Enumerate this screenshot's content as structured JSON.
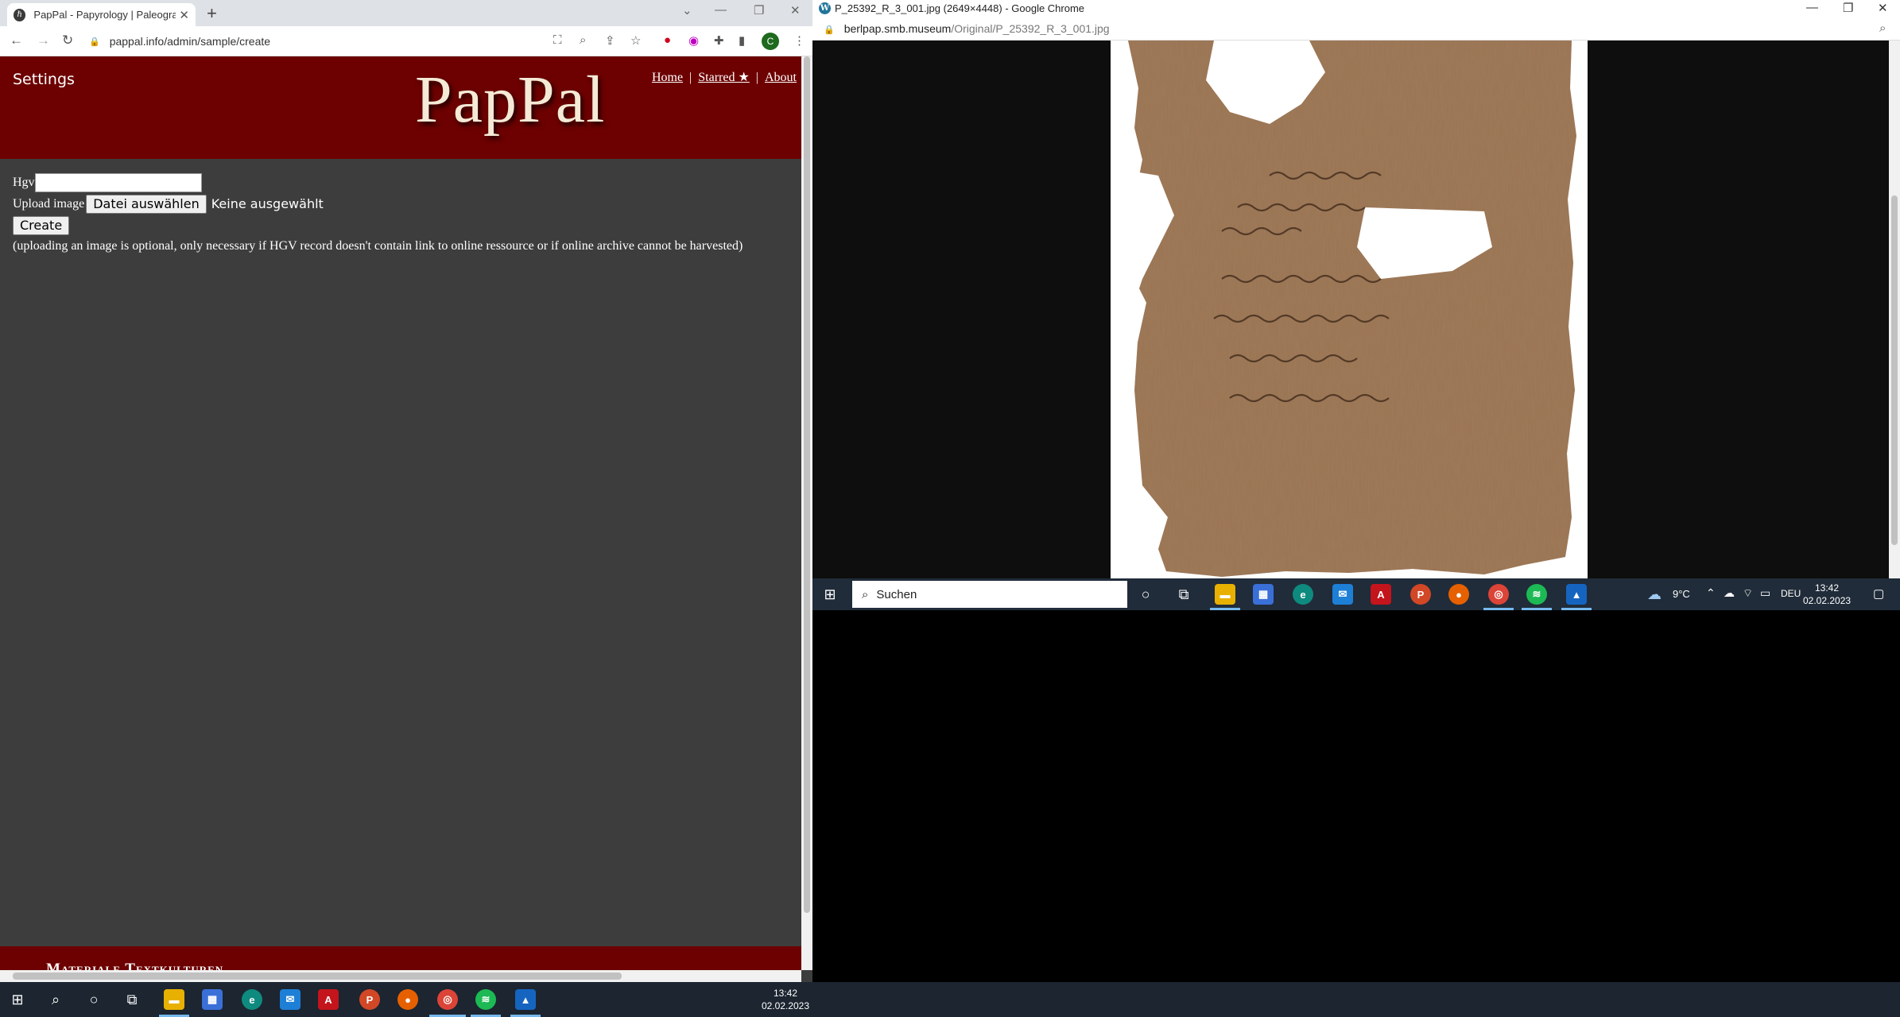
{
  "left_browser": {
    "tab_title": "PapPal - Papyrology | Paleograph",
    "tab_favicon": "ℏ",
    "url": "pappal.info/admin/sample/create",
    "profile_initial": "C"
  },
  "site": {
    "settings_link": "Settings",
    "logo": "PapPal",
    "nav": {
      "home": "Home",
      "starred": "Starred ★",
      "about": "About",
      "sep": "|"
    },
    "form": {
      "hgv_label": "Hgv",
      "hgv_value": "",
      "upload_label": "Upload image",
      "file_button": "Datei auswählen",
      "file_status": "Keine ausgewählt",
      "create_button": "Create",
      "note": "(uploading an image is optional, only necessary if HGV record doesn't contain link to online ressource or if online archive cannot be harvested)"
    },
    "footer": "Materiale Textkulturen"
  },
  "right_browser": {
    "title": "P_25392_R_3_001.jpg (2649×4448) - Google Chrome",
    "url_host": "berlpap.smb.museum",
    "url_path": "/Original/P_25392_R_3_001.jpg"
  },
  "right_taskbar": {
    "search_placeholder": "Suchen",
    "weather": "9°C",
    "lang": "DEU",
    "time": "13:42",
    "date": "02.02.2023"
  },
  "main_taskbar": {
    "time": "13:42",
    "date": "02.02.2023"
  },
  "colors": {
    "header_bg": "#6d0000",
    "page_bg": "#3d3d3d"
  }
}
